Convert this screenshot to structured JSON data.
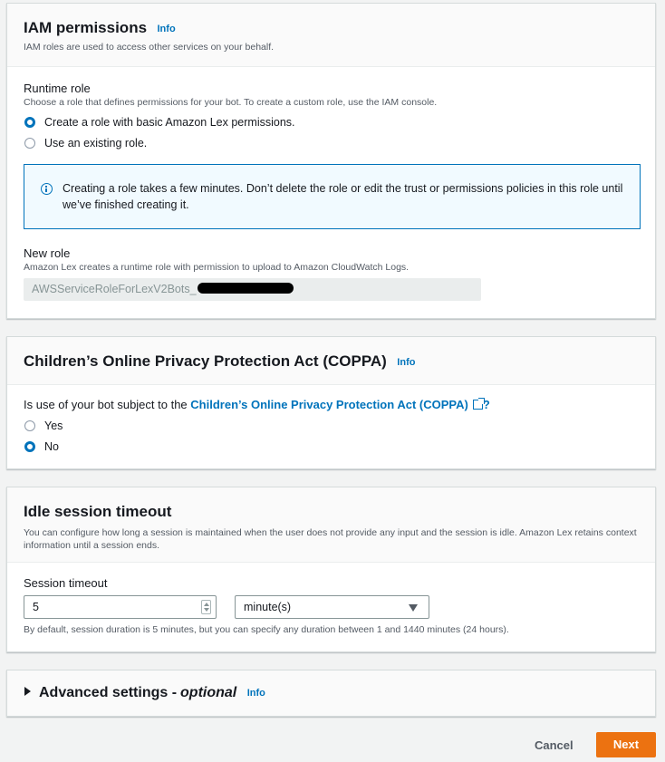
{
  "iam": {
    "title": "IAM permissions",
    "info": "Info",
    "description": "IAM roles are used to access other services on your behalf.",
    "runtime_role_label": "Runtime role",
    "runtime_role_desc": "Choose a role that defines permissions for your bot. To create a custom role, use the IAM console.",
    "options": [
      {
        "label": "Create a role with basic Amazon Lex permissions.",
        "selected": true
      },
      {
        "label": "Use an existing role.",
        "selected": false
      }
    ],
    "alert": "Creating a role takes a few minutes. Don’t delete the role or edit the trust or permissions policies in this role until we’ve finished creating it.",
    "new_role_label": "New role",
    "new_role_desc": "Amazon Lex creates a runtime role with permission to upload to Amazon CloudWatch Logs.",
    "new_role_value": "AWSServiceRoleForLexV2Bots_"
  },
  "coppa": {
    "title": "Children’s Online Privacy Protection Act (COPPA)",
    "info": "Info",
    "question_prefix": "Is use of your bot subject to the ",
    "question_link": "Children’s Online Privacy Protection Act (COPPA)",
    "question_suffix": "?",
    "options": [
      {
        "label": "Yes",
        "selected": false
      },
      {
        "label": "No",
        "selected": true
      }
    ]
  },
  "idle": {
    "title": "Idle session timeout",
    "description": "You can configure how long a session is maintained when the user does not provide any input and the session is idle. Amazon Lex retains context information until a session ends.",
    "session_timeout_label": "Session timeout",
    "timeout_value": "5",
    "unit_value": "minute(s)",
    "hint": "By default, session duration is 5 minutes, but you can specify any duration between 1 and 1440 minutes (24 hours)."
  },
  "advanced": {
    "title": "Advanced settings - ",
    "optional": "optional",
    "info": "Info"
  },
  "footer": {
    "cancel": "Cancel",
    "next": "Next"
  },
  "colors": {
    "accent": "#0073bb",
    "primary_button": "#ec7211"
  }
}
